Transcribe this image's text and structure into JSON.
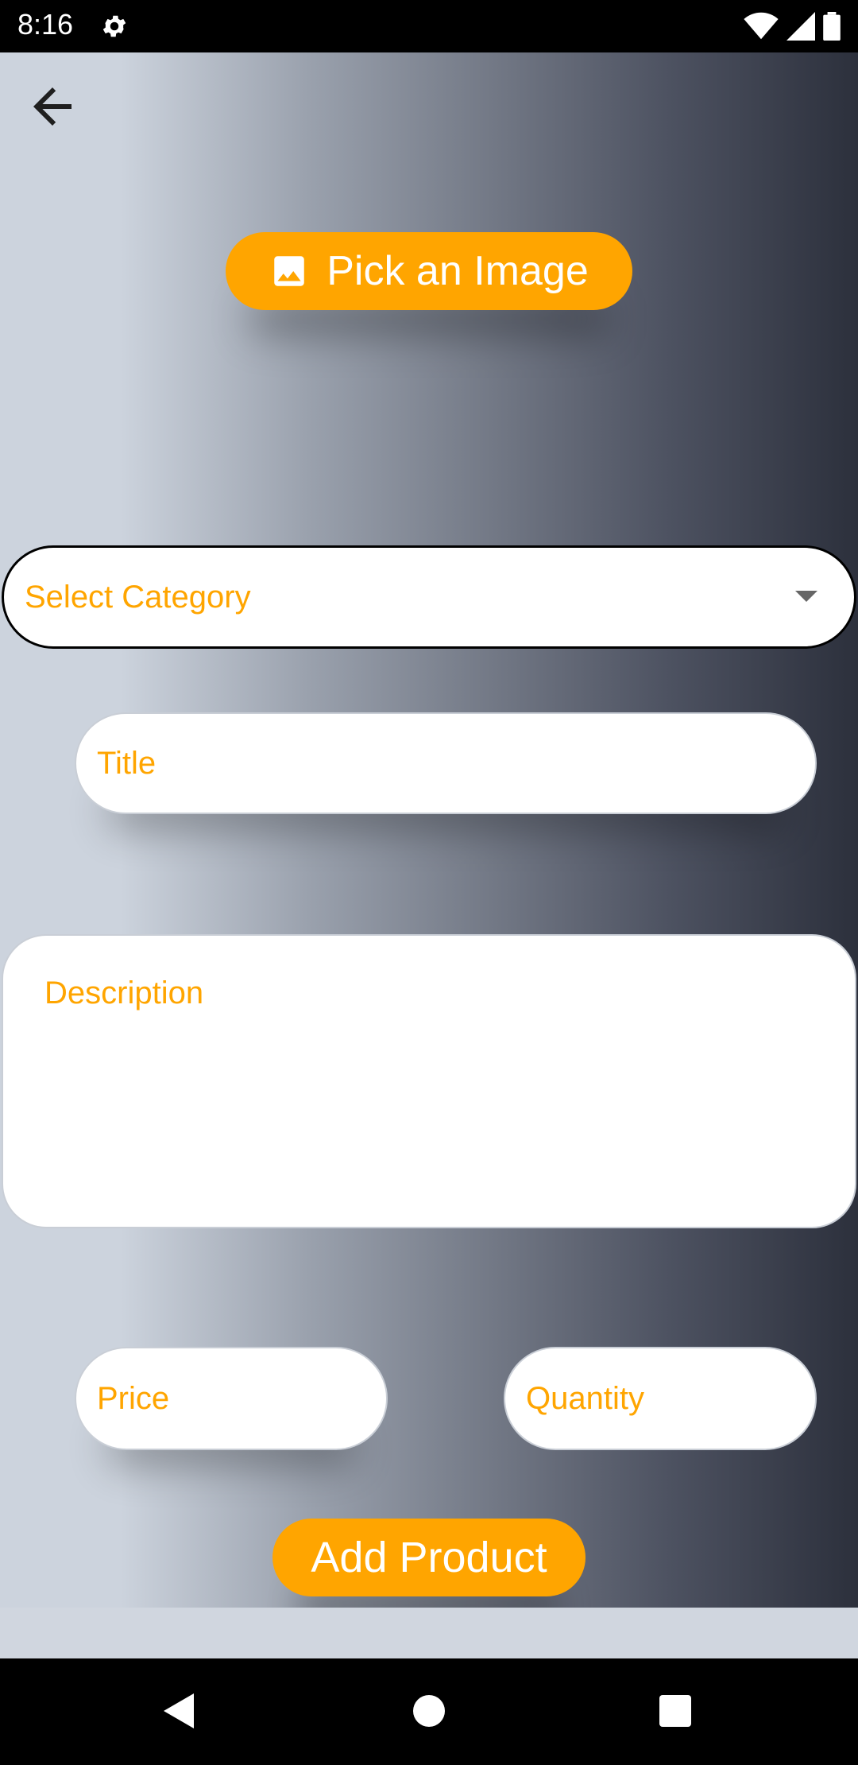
{
  "status_bar": {
    "time": "8:16",
    "icons": [
      "gear-icon",
      "wifi-icon",
      "signal-icon",
      "battery-icon"
    ]
  },
  "header": {
    "back_icon": "arrow-left-icon"
  },
  "pick_image": {
    "label": "Pick an Image",
    "icon": "image-icon"
  },
  "form": {
    "category_placeholder": "Select Category",
    "title_placeholder": "Title",
    "description_placeholder": "Description",
    "price_placeholder": "Price",
    "quantity_placeholder": "Quantity"
  },
  "add_button": {
    "label": "Add Product"
  },
  "colors": {
    "accent": "#ffa500",
    "status_bar": "#000000",
    "nav_bar": "#000000"
  },
  "nav": {
    "icons": [
      "back-triangle-icon",
      "home-circle-icon",
      "recents-square-icon"
    ]
  }
}
